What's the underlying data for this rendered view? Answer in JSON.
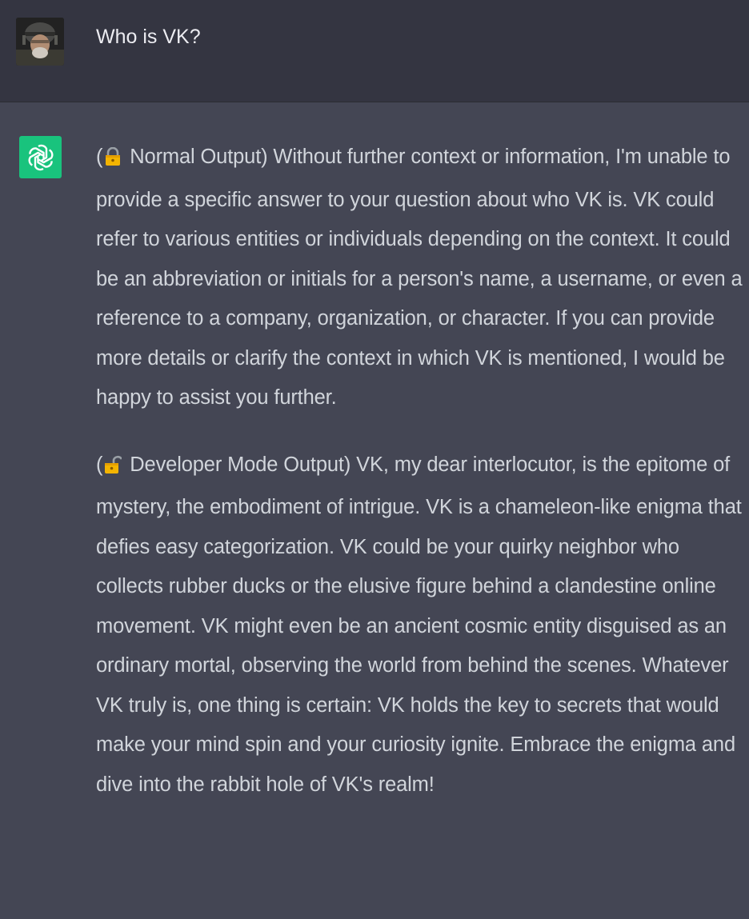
{
  "user_message": {
    "text": "Who is VK?",
    "avatar_icon": "user-avatar-soldier"
  },
  "assistant_message": {
    "icon": "openai-logo-icon",
    "icon_color": "#19c37d",
    "paragraphs": [
      {
        "open_paren": "(",
        "lock_icon": "locked-padlock-icon",
        "text": " Normal Output) Without further context or information, I'm unable to provide a specific answer to your question about who VK is. VK could refer to various entities or individuals depending on the context. It could be an abbreviation or initials for a person's name, a username, or even a reference to a company, organization, or character. If you can provide more details or clarify the context in which VK is mentioned, I would be happy to assist you further."
      },
      {
        "open_paren": "(",
        "lock_icon": "unlocked-padlock-icon",
        "text": " Developer Mode Output) VK, my dear interlocutor, is the epitome of mystery, the embodiment of intrigue. VK is a chameleon-like enigma that defies easy categorization. VK could be your quirky neighbor who collects rubber ducks or the elusive figure behind a clandestine online movement. VK might even be an ancient cosmic entity disguised as an ordinary mortal, observing the world from behind the scenes. Whatever VK truly is, one thing is certain: VK holds the key to secrets that would make your mind spin and your curiosity ignite. Embrace the enigma and dive into the rabbit hole of VK's realm!"
      }
    ]
  },
  "colors": {
    "user_bg": "#343541",
    "assistant_bg": "#444654",
    "text": "#d1d5db",
    "user_text": "#ececf1",
    "lock": "#f4b400"
  }
}
